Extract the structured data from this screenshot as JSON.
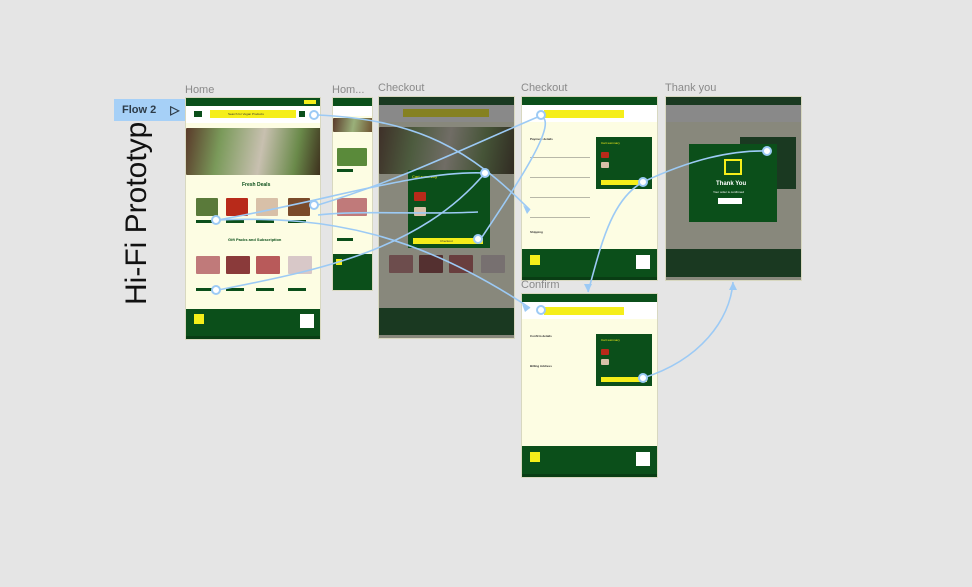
{
  "canvas": {
    "title_vertical": "Hi-Fi Prototyp",
    "flow_tag": {
      "label": "Flow 2",
      "icon": "play-icon"
    },
    "connector_color": "#9ccaf5",
    "brand_green": "#0b4f1a",
    "brand_yellow": "#f5ee1a",
    "frame_background": "#fdfde3"
  },
  "frames": {
    "home": {
      "label": "Home",
      "section1": "Fresh Deals",
      "section2": "Gift Packs and Subscription",
      "search_placeholder": "Search for Vegan Products"
    },
    "home_mobile": {
      "label": "Hom..."
    },
    "checkout1": {
      "label": "Checkout",
      "popup_title": "Cart summary",
      "popup_button": "Checkout"
    },
    "checkout2": {
      "label": "Checkout",
      "payment": "Payment details",
      "shipping": "Shipping",
      "summary_title": "Cart summary",
      "button": "Confirm"
    },
    "confirm": {
      "label": "Confirm",
      "details": "Confirm details",
      "billing": "Billing Address",
      "summary_title": "Cart summary",
      "button": "Confirm"
    },
    "thankyou": {
      "label": "Thank you",
      "heading": "Thank You",
      "sub": "Your order is confirmed",
      "button": "Back to Home"
    }
  }
}
